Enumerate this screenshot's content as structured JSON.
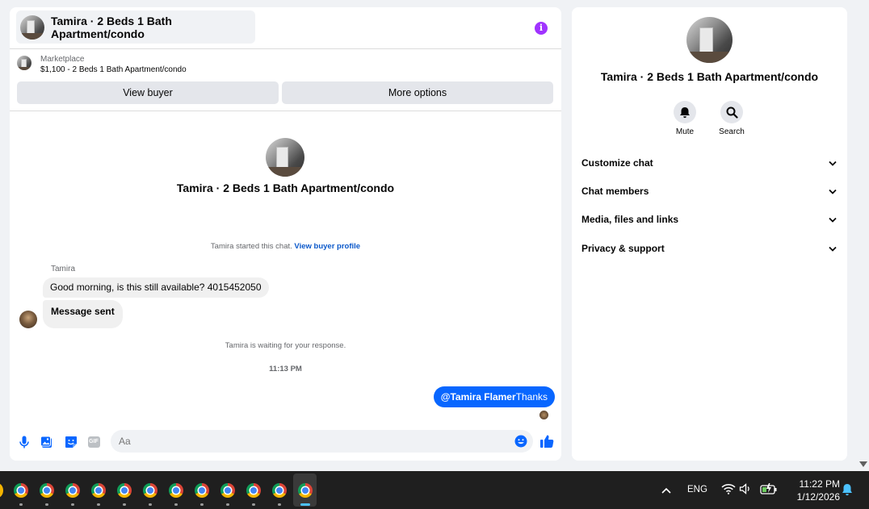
{
  "chat": {
    "header_title": "Tamira · 2 Beds 1 Bath Apartment/condo",
    "info_icon_glyph": "i",
    "marketplace_label": "Marketplace",
    "listing_summary": "$1,100 - 2 Beds 1 Bath Apartment/condo",
    "view_buyer_label": "View buyer",
    "more_options_label": "More options",
    "center_name": "Tamira · 2 Beds 1 Bath Apartment/condo",
    "started_text": "Tamira started this chat.",
    "view_profile_link": "View buyer profile",
    "sender_name": "Tamira",
    "messages": [
      {
        "from": "Tamira",
        "text": "Good morning, is this still available? 4015452050"
      },
      {
        "from": "Tamira",
        "text": "Message sent"
      }
    ],
    "waiting_text": "Tamira is waiting for your response.",
    "timestamp": "11:13 PM",
    "outgoing": {
      "mention": "@Tamira Flamer",
      "text": "Thanks"
    },
    "composer_placeholder": "Aa",
    "gif_label": "GIF"
  },
  "info": {
    "name": "Tamira · 2 Beds 1 Bath Apartment/condo",
    "mute_label": "Mute",
    "search_label": "Search",
    "menu": [
      "Customize chat",
      "Chat members",
      "Media, files and links",
      "Privacy & support"
    ]
  },
  "taskbar": {
    "language": "ENG",
    "time": "11:22 PM",
    "date": "1/12/2026",
    "pinned_app_count": 12
  },
  "colors": {
    "accent": "#0866ff",
    "info_icon": "#a033ff",
    "taskbar_active": "#4cc2ff"
  }
}
